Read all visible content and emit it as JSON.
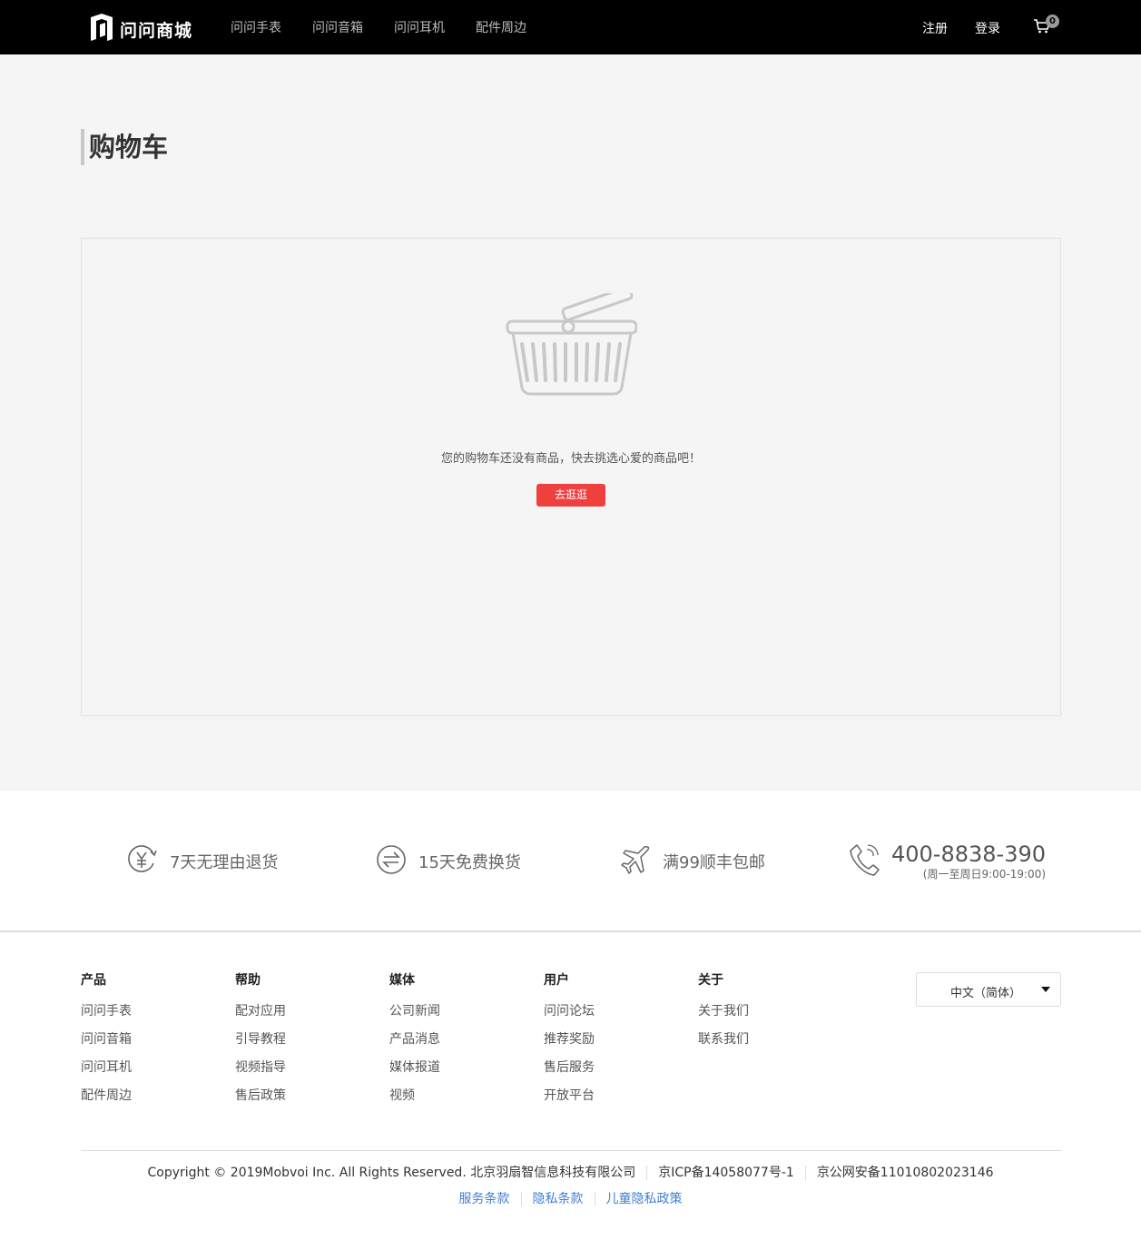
{
  "header": {
    "brand": "问问商城",
    "nav": [
      "问问手表",
      "问问音箱",
      "问问耳机",
      "配件周边"
    ],
    "register": "注册",
    "login": "登录",
    "cart_count": "0"
  },
  "main": {
    "title": "购物车",
    "empty_message": "您的购物车还没有商品，快去挑选心爱的商品吧！",
    "go_button": "去逛逛",
    "button_color": "#ef4040"
  },
  "services": [
    {
      "icon": "yuan-return-icon",
      "text": "7天无理由退货"
    },
    {
      "icon": "exchange-icon",
      "text": "15天免费换货"
    },
    {
      "icon": "airplane-icon",
      "text": "满99顺丰包邮"
    },
    {
      "icon": "phone-icon",
      "phone": "400-8838-390",
      "hours": "(周一至周日9:00-19:00)"
    }
  ],
  "footer": {
    "columns": [
      {
        "title": "产品",
        "links": [
          "问问手表",
          "问问音箱",
          "问问耳机",
          "配件周边"
        ]
      },
      {
        "title": "帮助",
        "links": [
          "配对应用",
          "引导教程",
          "视频指导",
          "售后政策"
        ]
      },
      {
        "title": "媒体",
        "links": [
          "公司新闻",
          "产品消息",
          "媒体报道",
          "视频"
        ]
      },
      {
        "title": "用户",
        "links": [
          "问问论坛",
          "推荐奖励",
          "售后服务",
          "开放平台"
        ]
      },
      {
        "title": "关于",
        "links": [
          "关于我们",
          "联系我们"
        ]
      }
    ],
    "language": "中文（简体）",
    "copyright": "Copyright © 2019Mobvoi Inc. All Rights Reserved. 北京羽扇智信息科技有限公司",
    "icp": "京ICP备14058077号-1",
    "police": "京公网安备11010802023146",
    "legal_links": [
      "服务条款",
      "隐私条款",
      "儿童隐私政策"
    ],
    "link_color": "#3f7fcf"
  }
}
